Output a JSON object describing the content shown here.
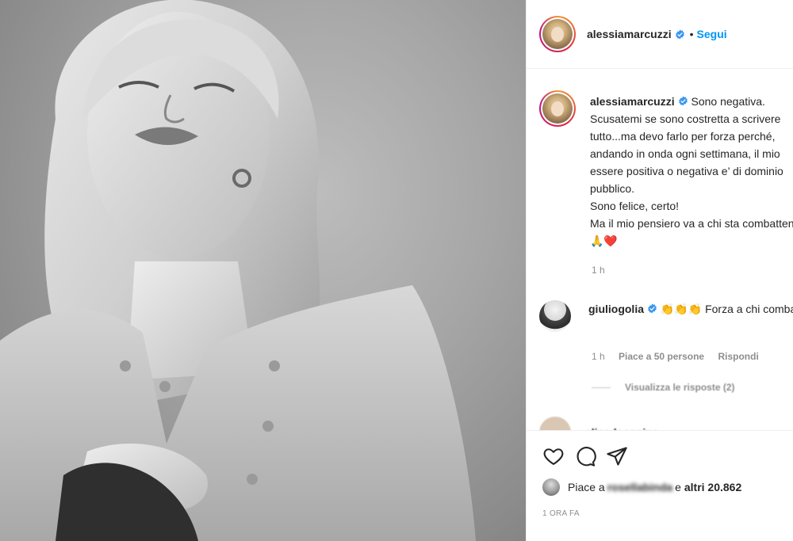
{
  "post": {
    "author": "alessiamarcuzzi",
    "follow_label": "Segui",
    "separator": "•",
    "photo_alt": "Black and white portrait"
  },
  "caption": {
    "author": "alessiamarcuzzi",
    "text": "Sono negativa. Scusatemi se sono costretta a scrivere tutto...ma devo farlo per forza perché, andando in onda ogni settimana, il mio essere positiva o negativa e’ di dominio pubblico.\nSono felice, certo!\nMa il mio pensiero va a chi sta combattendo🙏❤️",
    "time": "1 h"
  },
  "comment": {
    "author": "giuliogolia",
    "text": "👏👏👏 Forza a chi combatte",
    "time": "1 h",
    "likes": "Piace a 50 persone",
    "reply": "Rispondi",
    "view_replies": "Visualizza le risposte (2)"
  },
  "partial_comment": {
    "author": "elisadaospina"
  },
  "actions": {
    "likes_prefix": "Piace a",
    "likes_user": "rosellabinda",
    "likes_mid": "e",
    "likes_count": "altri 20.862",
    "timestamp": "1 ORA FA"
  },
  "colors": {
    "accent": "#0095f6",
    "text": "#262626",
    "muted": "#8e8e8e",
    "heart": "#ed4956"
  }
}
